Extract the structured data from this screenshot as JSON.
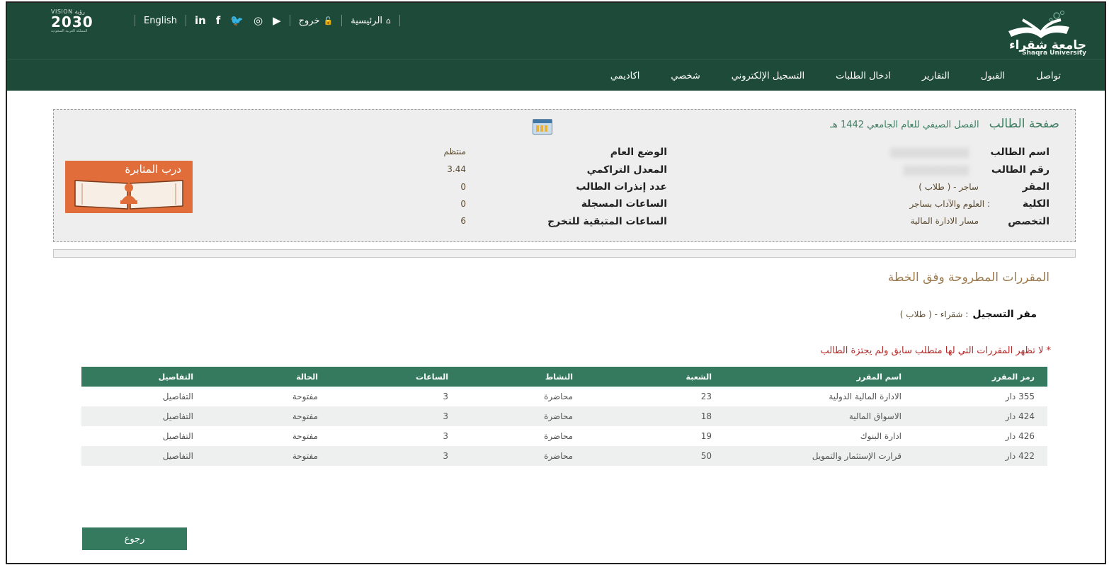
{
  "header": {
    "vision_small": "VISION رؤية",
    "vision_year": "2030",
    "vision_sub": "المملكة العربية السعودية",
    "english_link": "English",
    "social": [
      "in",
      "f",
      "🐦",
      "◎",
      "▶"
    ],
    "logout": "خروج",
    "home": "الرئيسية",
    "logo_ar": "جامعة شقراء",
    "logo_en": "Shaqra University",
    "nav": [
      "اكاديمي",
      "شخصي",
      "التسجيل الإلكتروني",
      "ادخال الطلبات",
      "التقارير",
      "القبول",
      "تواصل"
    ]
  },
  "student": {
    "page_title": "صفحة الطالب",
    "term": "الفصل الصيفي للعام الجامعي 1442 هـ",
    "rows_right": [
      {
        "label": "اسم الطالب",
        "value": "████████████"
      },
      {
        "label": "رقم الطالب",
        "value": "██████████"
      },
      {
        "label": "المقر",
        "value": "ساجر - ( طلاب )"
      },
      {
        "label": "الكلية",
        "value": ": العلوم والآداب بساجر"
      },
      {
        "label": "التخصص",
        "value": "مسار الادارة المالية"
      }
    ],
    "rows_left": [
      {
        "label": "الوضع العام",
        "value": "منتظم"
      },
      {
        "label": "المعدل التراكمي",
        "value": "3.44"
      },
      {
        "label": "عدد إنذرات الطالب",
        "value": "0"
      },
      {
        "label": "الساعات المسجلة",
        "value": "0"
      },
      {
        "label": "الساعات المتبقية للتخرج",
        "value": "6"
      }
    ],
    "badge_text": "درب المثابرة"
  },
  "courses": {
    "section_title": "المقررات المطروحة وفق الخطة",
    "reg_label": "مقر التسجيل",
    "reg_value": ": شقراء - ( طلاب )",
    "note": "* لا تظهر المقررات التي لها متطلب سابق ولم يجتزة الطالب",
    "columns": [
      "رمز المقرر",
      "اسم المقرر",
      "الشعبة",
      "النشاط",
      "الساعات",
      "الحالة",
      "التفاصيل"
    ],
    "rows": [
      [
        "355 دار",
        "الادارة المالية الدولية",
        "23",
        "محاضرة",
        "3",
        "مفتوحة",
        "التفاصيل"
      ],
      [
        "424 دار",
        "الاسواق المالية",
        "18",
        "محاضرة",
        "3",
        "مفتوحة",
        "التفاصيل"
      ],
      [
        "426 دار",
        "ادارة البنوك",
        "19",
        "محاضرة",
        "3",
        "مفتوحة",
        "التفاصيل"
      ],
      [
        "422 دار",
        "قرارت الإستثمار والتمويل",
        "50",
        "محاضرة",
        "3",
        "مفتوحة",
        "التفاصيل"
      ]
    ],
    "back_label": "رجوع"
  },
  "colors": {
    "header_bg": "#1e4a3a",
    "accent": "#357a5f",
    "badge": "#e06d3a",
    "note": "#b22727"
  }
}
